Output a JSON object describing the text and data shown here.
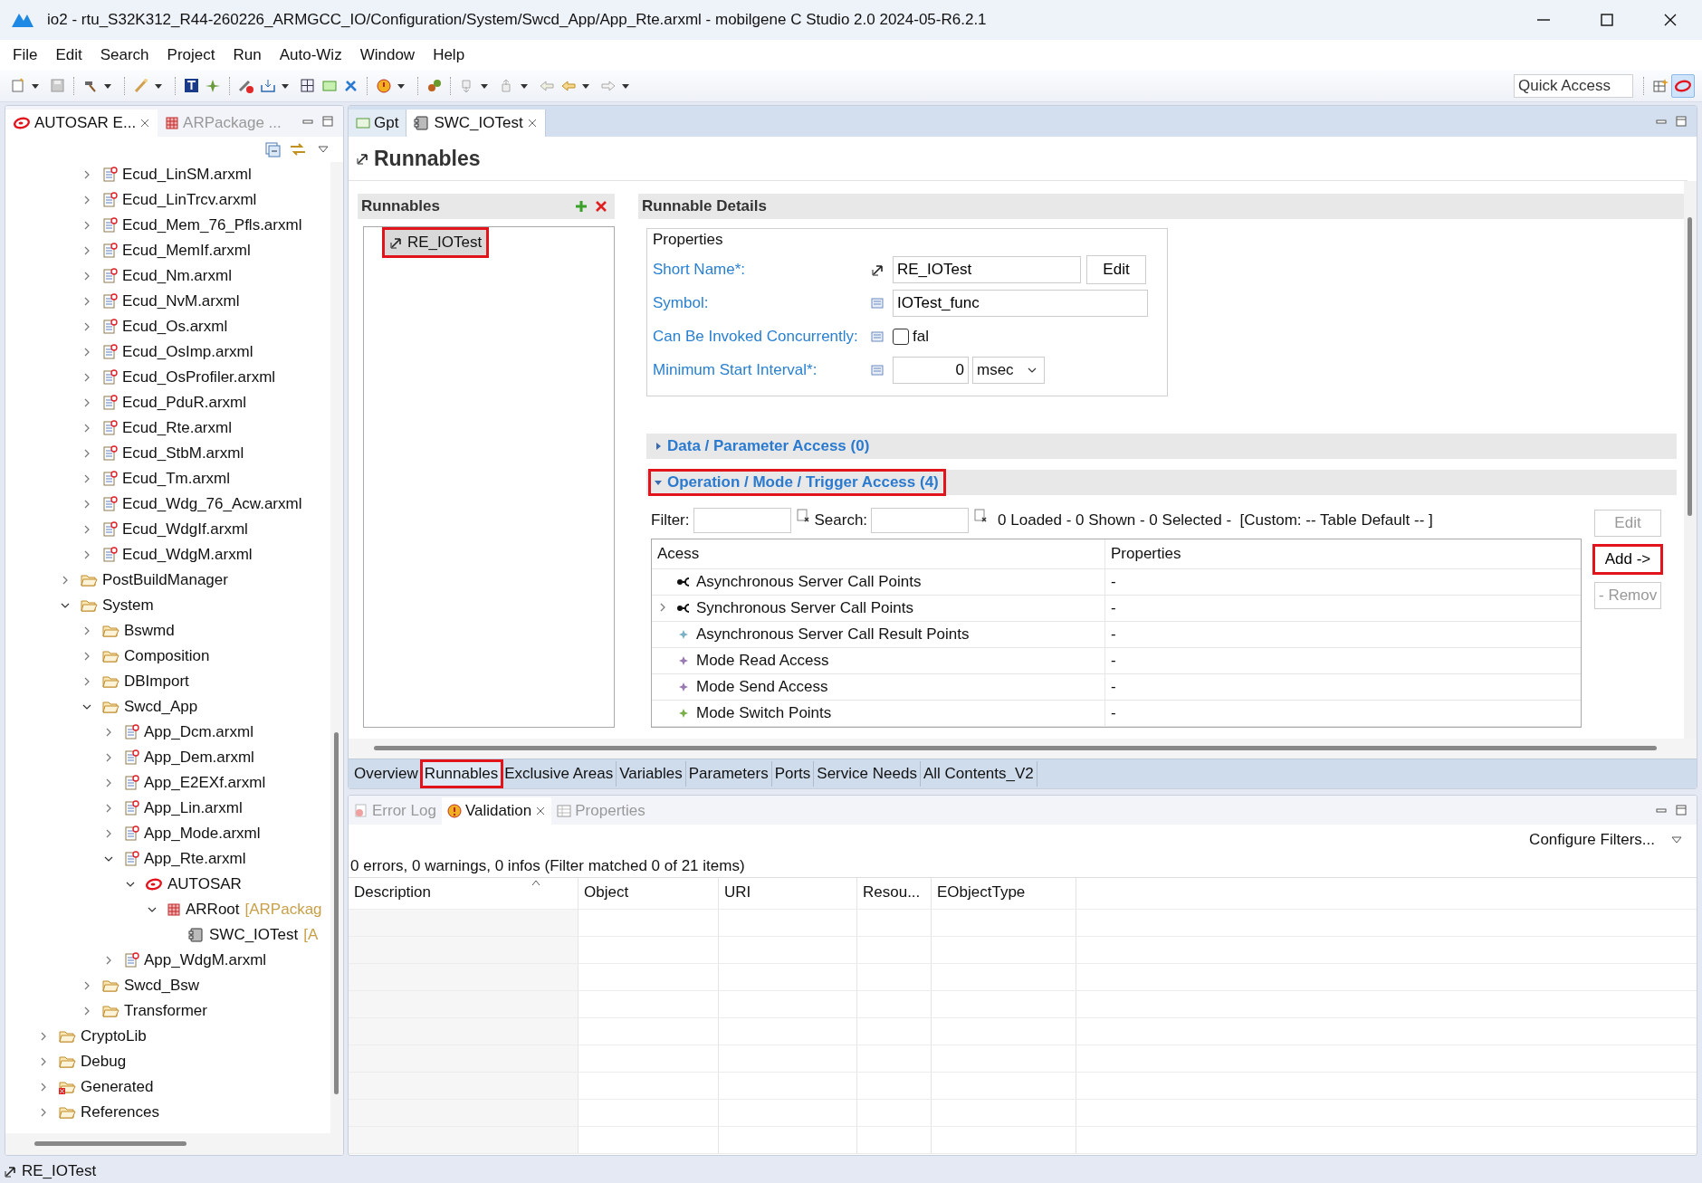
{
  "window": {
    "title": "io2 - rtu_S32K312_R44-260226_ARMGCC_IO/Configuration/System/Swcd_App/App_Rte.arxml - mobilgene C Studio 2.0 2024-05-R6.2.1"
  },
  "menu": [
    "File",
    "Edit",
    "Search",
    "Project",
    "Run",
    "Auto-Wiz",
    "Window",
    "Help"
  ],
  "toolbar": {
    "quick_access": {
      "placeholder": "Quick Access"
    }
  },
  "left_panel": {
    "tabs": [
      {
        "label": "AUTOSAR E...",
        "selected": true,
        "kind": "autosar"
      },
      {
        "label": "ARPackage ...",
        "selected": false,
        "kind": "package"
      }
    ],
    "tree": [
      {
        "children": [
          {
            "children": [
              {
                "label": "Ecud_LinSM.arxml",
                "kind": "file",
                "expanded": false
              },
              {
                "label": "Ecud_LinTrcv.arxml",
                "kind": "file",
                "expanded": false
              },
              {
                "label": "Ecud_Mem_76_Pfls.arxml",
                "kind": "file",
                "expanded": false
              },
              {
                "label": "Ecud_MemIf.arxml",
                "kind": "file",
                "expanded": false
              },
              {
                "label": "Ecud_Nm.arxml",
                "kind": "file",
                "expanded": false
              },
              {
                "label": "Ecud_NvM.arxml",
                "kind": "file",
                "expanded": false
              },
              {
                "label": "Ecud_Os.arxml",
                "kind": "file",
                "expanded": false
              },
              {
                "label": "Ecud_OsImp.arxml",
                "kind": "file",
                "expanded": false
              },
              {
                "label": "Ecud_OsProfiler.arxml",
                "kind": "file",
                "expanded": false
              },
              {
                "label": "Ecud_PduR.arxml",
                "kind": "file",
                "expanded": false
              },
              {
                "label": "Ecud_Rte.arxml",
                "kind": "file",
                "expanded": false
              },
              {
                "label": "Ecud_StbM.arxml",
                "kind": "file",
                "expanded": false
              },
              {
                "label": "Ecud_Tm.arxml",
                "kind": "file",
                "expanded": false
              },
              {
                "label": "Ecud_Wdg_76_Acw.arxml",
                "kind": "file",
                "expanded": false
              },
              {
                "label": "Ecud_WdgIf.arxml",
                "kind": "file",
                "expanded": false
              },
              {
                "label": "Ecud_WdgM.arxml",
                "kind": "file",
                "expanded": false
              }
            ]
          },
          {
            "label": "PostBuildManager",
            "kind": "folder",
            "expanded": false
          },
          {
            "label": "System",
            "kind": "folder",
            "expanded": true,
            "children": [
              {
                "label": "Bswmd",
                "kind": "folder",
                "expanded": false
              },
              {
                "label": "Composition",
                "kind": "folder",
                "expanded": false
              },
              {
                "label": "DBImport",
                "kind": "folder",
                "expanded": false
              },
              {
                "label": "Swcd_App",
                "kind": "folder",
                "expanded": true,
                "children": [
                  {
                    "label": "App_Dcm.arxml",
                    "kind": "file",
                    "expanded": false
                  },
                  {
                    "label": "App_Dem.arxml",
                    "kind": "file",
                    "expanded": false
                  },
                  {
                    "label": "App_E2EXf.arxml",
                    "kind": "file",
                    "expanded": false
                  },
                  {
                    "label": "App_Lin.arxml",
                    "kind": "file",
                    "expanded": false
                  },
                  {
                    "label": "App_Mode.arxml",
                    "kind": "file",
                    "expanded": false
                  },
                  {
                    "label": "App_Rte.arxml",
                    "kind": "file",
                    "expanded": true,
                    "children": [
                      {
                        "label": "AUTOSAR",
                        "kind": "autosar",
                        "expanded": true,
                        "children": [
                          {
                            "label": "ARRoot",
                            "suffix": "[ARPackag",
                            "kind": "package",
                            "expanded": true,
                            "children": [
                              {
                                "label": "SWC_IOTest",
                                "suffix": "[A",
                                "kind": "component"
                              }
                            ]
                          }
                        ]
                      }
                    ]
                  },
                  {
                    "label": "App_WdgM.arxml",
                    "kind": "file",
                    "expanded": false
                  }
                ]
              },
              {
                "label": "Swcd_Bsw",
                "kind": "folder",
                "expanded": false
              },
              {
                "label": "Transformer",
                "kind": "folder",
                "expanded": false
              }
            ]
          }
        ]
      },
      {
        "label": "CryptoLib",
        "kind": "folder",
        "expanded": false
      },
      {
        "label": "Debug",
        "kind": "folder",
        "expanded": false
      },
      {
        "label": "Generated",
        "kind": "folder-error",
        "expanded": false
      },
      {
        "label": "References",
        "kind": "folder",
        "expanded": false
      }
    ]
  },
  "editor": {
    "tabs": [
      {
        "label": "Gpt",
        "selected": false,
        "kind": "panel"
      },
      {
        "label": "SWC_IOTest",
        "selected": true,
        "kind": "component"
      }
    ],
    "page_title": "Runnables",
    "runnables": {
      "title": "Runnables",
      "items": [
        {
          "label": "RE_IOTest",
          "selected": true,
          "annotated": true
        }
      ]
    },
    "details": {
      "title": "Runnable Details",
      "properties": {
        "title": "Properties",
        "short_name": {
          "label": "Short Name*:",
          "value": "RE_IOTest",
          "button": "Edit"
        },
        "symbol": {
          "label": "Symbol:",
          "value": "IOTest_func"
        },
        "concurrent": {
          "label": "Can Be Invoked Concurrently:",
          "checked": false,
          "value": "fal"
        },
        "min_interval": {
          "label": "Minimum Start Interval*:",
          "value": "0",
          "unit": "msec"
        }
      },
      "sections": [
        {
          "title": "Data / Parameter Access (0)",
          "expanded": false,
          "annotated": false
        },
        {
          "title": "Operation / Mode / Trigger Access (4)",
          "expanded": true,
          "annotated": true
        }
      ],
      "filter_label": "Filter:",
      "search_label": "Search:",
      "summary": "0 Loaded - 0 Shown - 0 Selected -  [Custom: -- Table Default -- ]",
      "table": {
        "columns": [
          "Acess",
          "Properties"
        ],
        "rows": [
          {
            "name": "Asynchronous Server Call Points",
            "value": "-",
            "kind": "call",
            "expander": false
          },
          {
            "name": "Synchronous Server Call Points",
            "value": "-",
            "kind": "call",
            "expander": true
          },
          {
            "name": "Asynchronous Server Call Result Points",
            "value": "-",
            "kind": "result",
            "expander": false
          },
          {
            "name": "Mode Read Access",
            "value": "-",
            "kind": "mode",
            "expander": false
          },
          {
            "name": "Mode Send Access",
            "value": "-",
            "kind": "mode",
            "expander": false
          },
          {
            "name": "Mode Switch Points",
            "value": "-",
            "kind": "switch",
            "expander": false
          }
        ]
      },
      "buttons": [
        {
          "label": "Edit",
          "disabled": true,
          "annotated": false
        },
        {
          "label": "Add ->",
          "disabled": false,
          "annotated": true
        },
        {
          "label": "- Remov",
          "disabled": true,
          "annotated": false
        }
      ]
    },
    "page_tabs": [
      {
        "label": "Overview",
        "selected": false,
        "annotated": false
      },
      {
        "label": "Runnables",
        "selected": true,
        "annotated": true
      },
      {
        "label": "Exclusive Areas",
        "selected": false,
        "annotated": false
      },
      {
        "label": "Variables",
        "selected": false,
        "annotated": false
      },
      {
        "label": "Parameters",
        "selected": false,
        "annotated": false
      },
      {
        "label": "Ports",
        "selected": false,
        "annotated": false
      },
      {
        "label": "Service Needs",
        "selected": false,
        "annotated": false
      },
      {
        "label": "All Contents_V2",
        "selected": false,
        "annotated": false
      }
    ]
  },
  "validation": {
    "tabs": [
      {
        "label": "Error Log",
        "selected": false,
        "kind": "error"
      },
      {
        "label": "Validation",
        "selected": true,
        "kind": "warning"
      },
      {
        "label": "Properties",
        "selected": false,
        "kind": "properties"
      }
    ],
    "configure": "Configure Filters...",
    "summary": "0 errors, 0 warnings, 0 infos (Filter matched 0 of 21 items)",
    "table": {
      "columns": [
        "Description",
        "Object",
        "URI",
        "Resou...",
        "EObjectType"
      ]
    }
  },
  "status_bar": {
    "text": "RE_IOTest"
  }
}
